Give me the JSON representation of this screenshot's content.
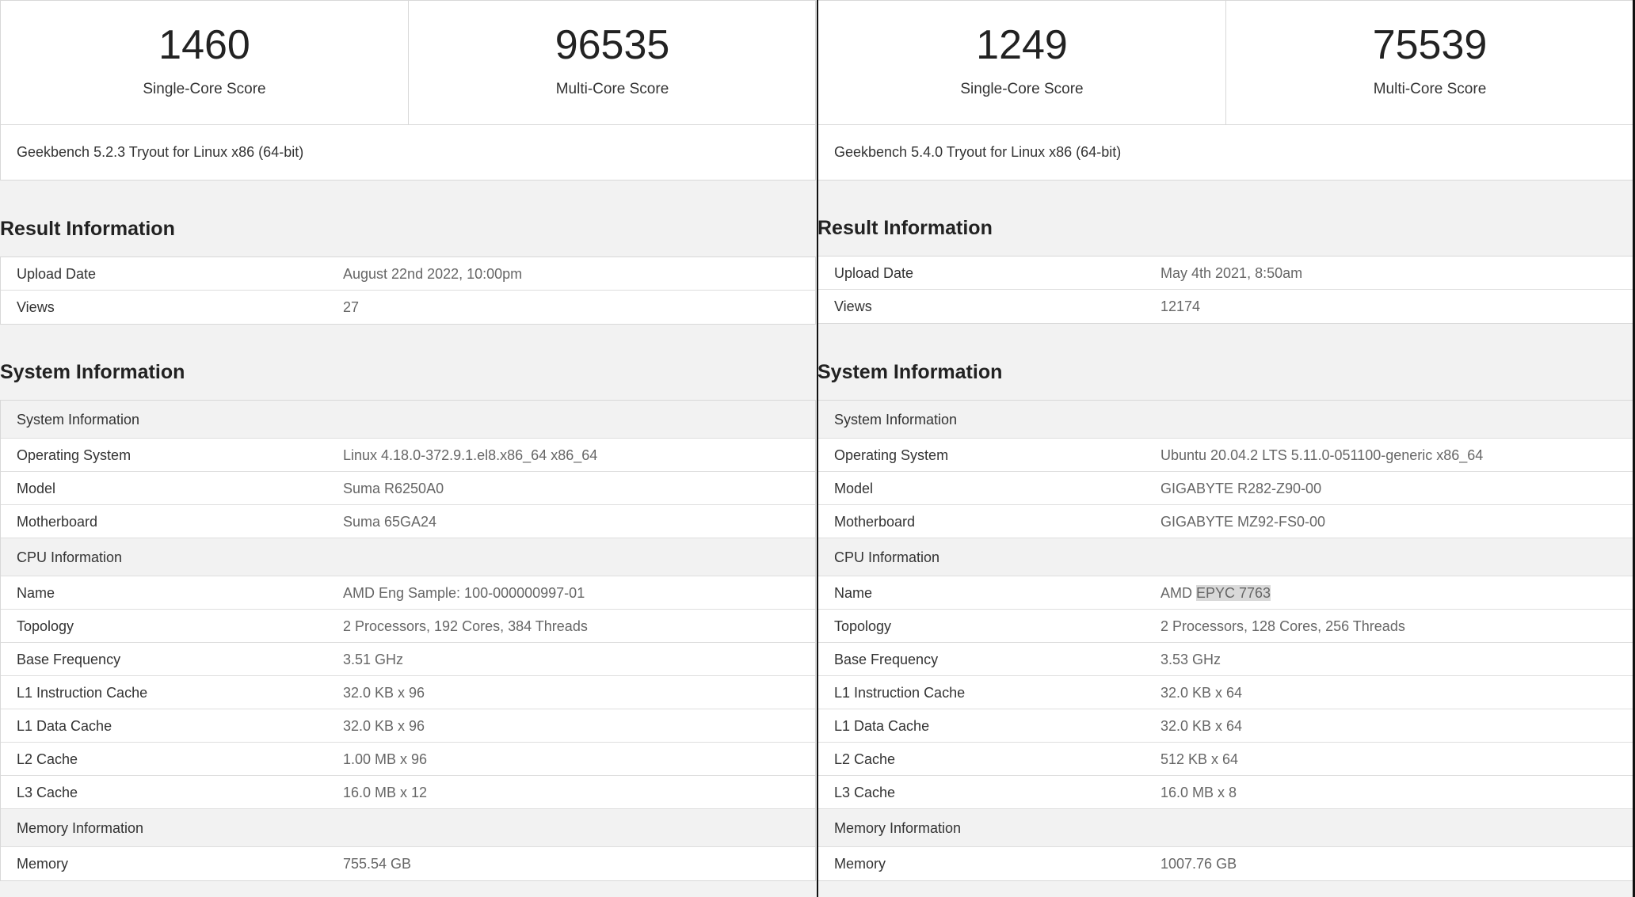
{
  "left": {
    "single_score": "1460",
    "single_label": "Single-Core Score",
    "multi_score": "96535",
    "multi_label": "Multi-Core Score",
    "version": "Geekbench 5.2.3 Tryout for Linux x86 (64-bit)",
    "result_title": "Result Information",
    "upload_label": "Upload Date",
    "upload_value": "August 22nd 2022, 10:00pm",
    "views_label": "Views",
    "views_value": "27",
    "system_title": "System Information",
    "sys_head": "System Information",
    "os_label": "Operating System",
    "os_value": "Linux 4.18.0-372.9.1.el8.x86_64 x86_64",
    "model_label": "Model",
    "model_value": "Suma R6250A0",
    "mb_label": "Motherboard",
    "mb_value": "Suma 65GA24",
    "cpu_head": "CPU Information",
    "name_label": "Name",
    "name_value": "AMD Eng Sample: 100-000000997-01",
    "topo_label": "Topology",
    "topo_value": "2 Processors, 192 Cores, 384 Threads",
    "freq_label": "Base Frequency",
    "freq_value": "3.51 GHz",
    "l1i_label": "L1 Instruction Cache",
    "l1i_value": "32.0 KB x 96",
    "l1d_label": "L1 Data Cache",
    "l1d_value": "32.0 KB x 96",
    "l2_label": "L2 Cache",
    "l2_value": "1.00 MB x 96",
    "l3_label": "L3 Cache",
    "l3_value": "16.0 MB x 12",
    "mem_head": "Memory Information",
    "mem_label": "Memory",
    "mem_value": "755.54 GB"
  },
  "right": {
    "single_score": "1249",
    "single_label": "Single-Core Score",
    "multi_score": "75539",
    "multi_label": "Multi-Core Score",
    "version": "Geekbench 5.4.0 Tryout for Linux x86 (64-bit)",
    "result_title": "Result Information",
    "upload_label": "Upload Date",
    "upload_value": "May 4th 2021, 8:50am",
    "views_label": "Views",
    "views_value": "12174",
    "system_title": "System Information",
    "sys_head": "System Information",
    "os_label": "Operating System",
    "os_value": "Ubuntu 20.04.2 LTS 5.11.0-051100-generic x86_64",
    "model_label": "Model",
    "model_value": "GIGABYTE R282-Z90-00",
    "mb_label": "Motherboard",
    "mb_value": "GIGABYTE MZ92-FS0-00",
    "cpu_head": "CPU Information",
    "name_label": "Name",
    "name_prefix": "AMD ",
    "name_highlight": "EPYC 7763",
    "topo_label": "Topology",
    "topo_value": "2 Processors, 128 Cores, 256 Threads",
    "freq_label": "Base Frequency",
    "freq_value": "3.53 GHz",
    "l1i_label": "L1 Instruction Cache",
    "l1i_value": "32.0 KB x 64",
    "l1d_label": "L1 Data Cache",
    "l1d_value": "32.0 KB x 64",
    "l2_label": "L2 Cache",
    "l2_value": "512 KB x 64",
    "l3_label": "L3 Cache",
    "l3_value": "16.0 MB x 8",
    "mem_head": "Memory Information",
    "mem_label": "Memory",
    "mem_value": "1007.76 GB"
  }
}
